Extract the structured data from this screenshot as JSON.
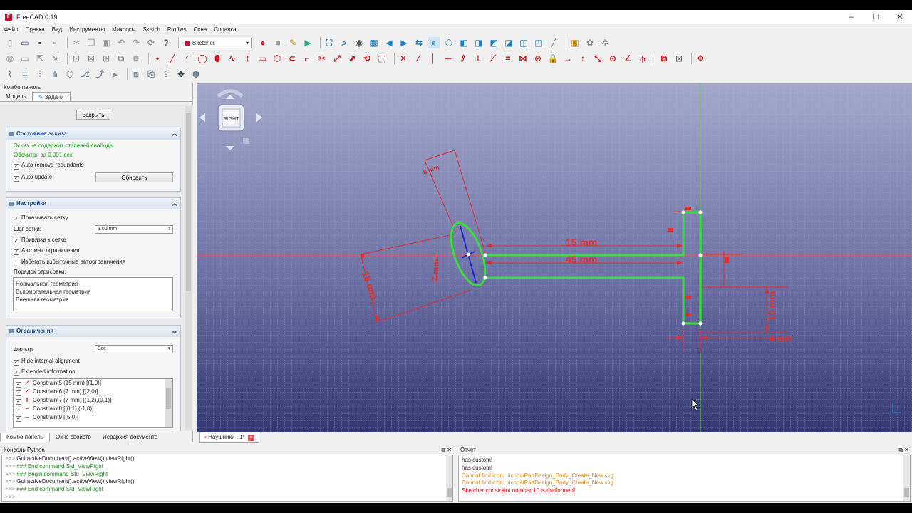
{
  "window": {
    "title": "FreeCAD 0.19",
    "min": "–",
    "max": "☐",
    "close": "✕"
  },
  "menu": [
    "Файл",
    "Правка",
    "Вид",
    "Инструменты",
    "Макросы",
    "Sketch",
    "Profiles",
    "Окна",
    "Справка"
  ],
  "workbench": "Sketcher",
  "combo": {
    "title": "Комбо панель",
    "tabs": [
      "Модель",
      "Задачи"
    ],
    "close_button": "Закрыть",
    "sketch_state": {
      "header": "Состояние эскиза",
      "dof_text": "Эскиз не содержит степеней свободы",
      "solved_text": "Обсчитан за 0.001 сек",
      "auto_remove": "Auto remove redundants",
      "auto_update": "Auto update",
      "update_button": "Обновить"
    },
    "settings": {
      "header": "Настройки",
      "show_grid": "Показывать сетку",
      "grid_step_label": "Шаг сетки:",
      "grid_step_value": "3.00 mm",
      "snap": "Привязка к сетке",
      "auto_constraints": "Автомат. ограничения",
      "avoid_redundant": "Избегать избыточные автоограничения",
      "render_order_label": "Порядок отрисовки:",
      "render_order": [
        "Нормальная геометрия",
        "Вспомогательная геометрия",
        "Внешняя геометрия"
      ]
    },
    "constraints": {
      "header": "Ограничения",
      "filter_label": "Фильтр:",
      "filter_value": "Все",
      "hide_internal": "Hide internal alignment",
      "extended_info": "Extended information",
      "items": [
        "Constraint5 (15 mm) [(1,0)]",
        "Constraint6 (7 mm) [(2,0)]",
        "Constraint7 (7 mm) [(1,2),(0,1)]",
        "Constraint8 [(0,1),(-1,0)]",
        "Constraint9 [(5,0)]"
      ]
    },
    "bottom_tabs": [
      "Комбо панель",
      "Окно свойств",
      "Иерархия документа"
    ]
  },
  "view": {
    "navcube": "RIGHT",
    "doc_tab": "Наушники : 1*",
    "dims": {
      "d15a": "15 mm",
      "d45": "45 mm",
      "d15b": "15 mm",
      "d7": "7 mm",
      "d10": "10 mm",
      "d4": "4 mm",
      "d8": "8 mm"
    }
  },
  "python_console": {
    "title": "Консоль Python",
    "lines": [
      {
        "p": ">>> ",
        "t": "Gui.activeDocument().activeView().viewRight()",
        "c": ""
      },
      {
        "p": ">>> ",
        "t": "### End command Std_ViewRight",
        "c": "cmt"
      },
      {
        "p": ">>> ",
        "t": "### Begin command Std_ViewRight",
        "c": "cmt"
      },
      {
        "p": ">>> ",
        "t": "Gui.activeDocument().activeView().viewRight()",
        "c": ""
      },
      {
        "p": ">>> ",
        "t": "### End command Std_ViewRight",
        "c": "cmt"
      },
      {
        "p": ">>> ",
        "t": "",
        "c": ""
      }
    ]
  },
  "report": {
    "title": "Отчет",
    "lines": [
      {
        "t": "has custom!",
        "c": ""
      },
      {
        "t": "has custom!",
        "c": ""
      },
      {
        "t": "Cannot find icon: :/icons/PartDesign_Body_Create_New.svg",
        "c": "orange"
      },
      {
        "t": "Cannot find icon: :/icons/PartDesign_Body_Create_New.svg",
        "c": "orange"
      },
      {
        "t": "Sketcher constraint number 10 is malformed!",
        "c": "red"
      }
    ]
  },
  "colors": {
    "geometry": "#3ddc3d",
    "dimension": "#e03030",
    "axis": "#ff4040",
    "background_top": "#9ea4c6",
    "background_bottom": "#3a3d78"
  }
}
